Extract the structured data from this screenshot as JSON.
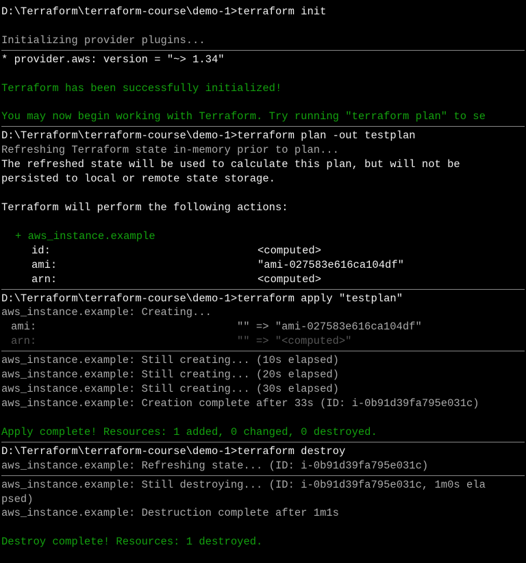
{
  "sec_init": {
    "prompt": "D:\\Terraform\\terraform-course\\demo-1>",
    "cmd": "terraform init",
    "init_msg": "Initializing provider plugins..."
  },
  "sec_provider": {
    "line": "* provider.aws: version = \"~> 1.34\"",
    "success": "Terraform has been successfully initialized!",
    "hint": "You may now begin working with Terraform. Try running \"terraform plan\" to se"
  },
  "sec_plan": {
    "prompt": "D:\\Terraform\\terraform-course\\demo-1>",
    "cmd": "terraform plan -out testplan",
    "refresh": "Refreshing Terraform state in-memory prior to plan...",
    "l1": "The refreshed state will be used to calculate this plan, but will not be",
    "l2": "persisted to local or remote state storage.",
    "actions": "Terraform will perform the following actions:",
    "resource": "+ aws_instance.example",
    "kv": {
      "id_k": "id:",
      "id_v": "<computed>",
      "ami_k": "ami:",
      "ami_v": "\"ami-027583e616ca104df\"",
      "arn_k": "arn:",
      "arn_v": "<computed>"
    }
  },
  "sec_apply_top": {
    "prompt": "D:\\Terraform\\terraform-course\\demo-1>",
    "cmd": "terraform apply \"testplan\"",
    "creating": "aws_instance.example: Creating...",
    "kv": {
      "ami_k": "ami:",
      "ami_v": "\"\" => \"ami-027583e616ca104df\"",
      "arn_k": "arn:",
      "arn_v": "\"\" => \"<computed>\""
    }
  },
  "sec_apply_mid": {
    "l1": "aws_instance.example: Still creating... (10s elapsed)",
    "l2": "aws_instance.example: Still creating... (20s elapsed)",
    "l3": "aws_instance.example: Still creating... (30s elapsed)",
    "l4": "aws_instance.example: Creation complete after 33s (ID: i-0b91d39fa795e031c)",
    "done": "Apply complete! Resources: 1 added, 0 changed, 0 destroyed."
  },
  "sec_destroy_top": {
    "prompt": "D:\\Terraform\\terraform-course\\demo-1>",
    "cmd": "terraform destroy",
    "refresh": "aws_instance.example: Refreshing state... (ID: i-0b91d39fa795e031c)"
  },
  "sec_destroy_mid": {
    "l1": "aws_instance.example: Still destroying... (ID: i-0b91d39fa795e031c, 1m0s ela",
    "l2": "psed)",
    "l3": "aws_instance.example: Destruction complete after 1m1s",
    "done": "Destroy complete! Resources: 1 destroyed."
  }
}
